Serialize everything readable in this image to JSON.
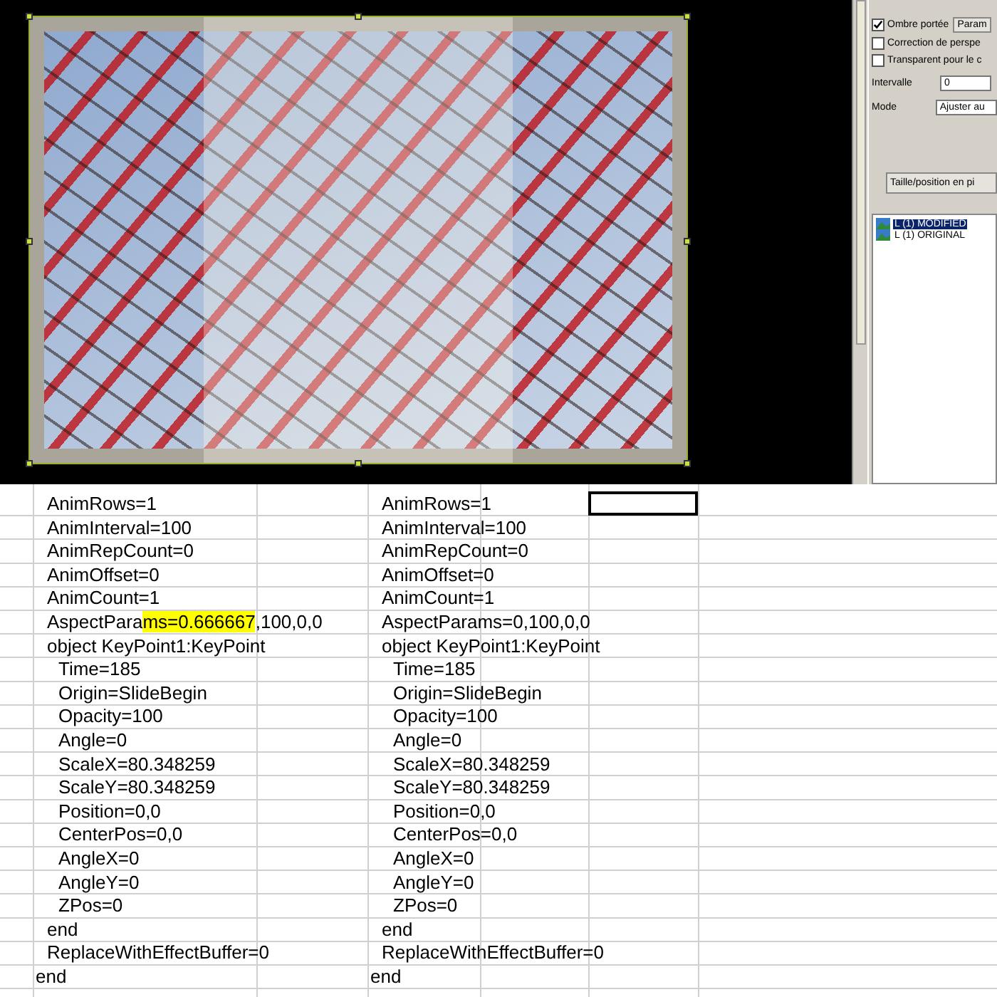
{
  "panel": {
    "options": [
      {
        "label": "Ombre portée",
        "checked": true,
        "button": "Param"
      },
      {
        "label": "Correction de perspe",
        "checked": false
      },
      {
        "label": "Transparent pour le c",
        "checked": false
      }
    ],
    "interval": {
      "label": "Intervalle",
      "value": "0"
    },
    "mode": {
      "label": "Mode",
      "value": "Ajuster au"
    },
    "size_button": "Taille/position en pi",
    "layers": [
      {
        "label": "L (1) MODIFIED",
        "selected": true
      },
      {
        "label": "L (1) ORIGINAL",
        "selected": false
      }
    ]
  },
  "sheet": {
    "rows": [
      {
        "left": {
          "parts": [
            "AnimRows=1"
          ]
        },
        "right": {
          "parts": [
            "AnimRows=1"
          ]
        },
        "cursor": true
      },
      {
        "left": {
          "parts": [
            "AnimInterval=100"
          ]
        },
        "right": {
          "parts": [
            "AnimInterval=100"
          ]
        },
        "cursor": false
      },
      {
        "left": {
          "parts": [
            "AnimRepCount=0"
          ]
        },
        "right": {
          "parts": [
            "AnimRepCount=0"
          ]
        },
        "cursor": false
      },
      {
        "left": {
          "parts": [
            "AnimOffset=0"
          ]
        },
        "right": {
          "parts": [
            "AnimOffset=0"
          ]
        },
        "cursor": false
      },
      {
        "left": {
          "parts": [
            "AnimCount=1"
          ]
        },
        "right": {
          "parts": [
            "AnimCount=1"
          ]
        },
        "cursor": false
      },
      {
        "left": {
          "parts": [
            "AspectPara",
            "ms=0.666667",
            ",100,0,0"
          ]
        },
        "right": {
          "parts": [
            "AspectParams=0,100,0,0"
          ]
        },
        "cursor": false
      },
      {
        "left": {
          "parts": [
            "object KeyPoint1:KeyPoint"
          ]
        },
        "right": {
          "parts": [
            "object KeyPoint1:KeyPoint"
          ]
        },
        "cursor": false,
        "children": [
          {
            "left": {
              "parts": [
                "Time=185"
              ]
            },
            "right": {
              "parts": [
                "Time=185"
              ]
            }
          },
          {
            "left": {
              "parts": [
                "Origin=SlideBegin"
              ]
            },
            "right": {
              "parts": [
                "Origin=SlideBegin"
              ]
            }
          },
          {
            "left": {
              "parts": [
                "Opacity=100"
              ]
            },
            "right": {
              "parts": [
                "Opacity=100"
              ]
            }
          },
          {
            "left": {
              "parts": [
                "Angle=0"
              ]
            },
            "right": {
              "parts": [
                "Angle=0"
              ]
            }
          },
          {
            "left": {
              "parts": [
                "ScaleX=80.348259"
              ]
            },
            "right": {
              "parts": [
                "ScaleX=80.348259"
              ]
            }
          },
          {
            "left": {
              "parts": [
                "ScaleY=80.348259"
              ]
            },
            "right": {
              "parts": [
                "ScaleY=80.348259"
              ]
            }
          },
          {
            "left": {
              "parts": [
                "Position=0,0"
              ]
            },
            "right": {
              "parts": [
                "Position=0,0"
              ]
            }
          },
          {
            "left": {
              "parts": [
                "CenterPos=0,0"
              ]
            },
            "right": {
              "parts": [
                "CenterPos=0,0"
              ]
            }
          },
          {
            "left": {
              "parts": [
                "AngleX=0"
              ]
            },
            "right": {
              "parts": [
                "AngleX=0"
              ]
            }
          },
          {
            "left": {
              "parts": [
                "AngleY=0"
              ]
            },
            "right": {
              "parts": [
                "AngleY=0"
              ]
            }
          },
          {
            "left": {
              "parts": [
                "ZPos=0"
              ]
            },
            "right": {
              "parts": [
                "ZPos=0"
              ]
            }
          }
        ]
      },
      {
        "left": {
          "parts": [
            "end"
          ]
        },
        "right": {
          "parts": [
            "end"
          ]
        },
        "cursor": false
      },
      {
        "left": {
          "parts": [
            "ReplaceWithEffectBuffer=0"
          ]
        },
        "right": {
          "parts": [
            "ReplaceWithEffectBuffer=0"
          ]
        },
        "cursor": false
      }
    ],
    "closing": {
      "left": "end",
      "right": "end"
    }
  }
}
